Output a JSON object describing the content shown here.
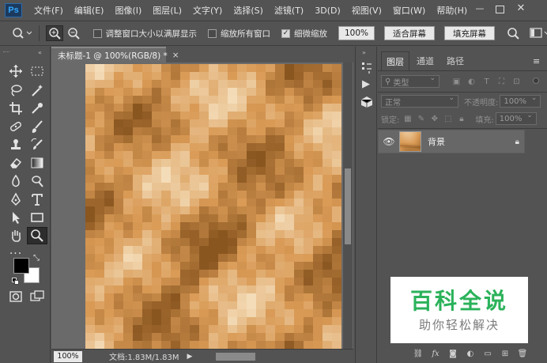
{
  "app": {
    "logo": "Ps"
  },
  "menu": [
    "文件(F)",
    "编辑(E)",
    "图像(I)",
    "图层(L)",
    "文字(Y)",
    "选择(S)",
    "滤镜(T)",
    "3D(D)",
    "视图(V)",
    "窗口(W)",
    "帮助(H)"
  ],
  "options": {
    "resize_windows_label": "调整窗口大小以满屏显示",
    "resize_windows_checked": false,
    "zoom_all_label": "缩放所有窗口",
    "zoom_all_checked": false,
    "scrubby_label": "细微缩放",
    "scrubby_checked": true,
    "percent_btn": "100%",
    "fit_screen_btn": "适合屏幕",
    "fill_screen_btn": "填充屏幕"
  },
  "document": {
    "tab_title": "未标题-1 @ 100%(RGB/8) *",
    "close_glyph": "×"
  },
  "status": {
    "zoom": "100%",
    "doc_size": "文档:1.83M/1.83M"
  },
  "layers_panel": {
    "tabs": [
      "图层",
      "通道",
      "路径"
    ],
    "filter_kind": "类型",
    "blend_mode": "正常",
    "opacity_label": "不透明度:",
    "opacity_value": "100%",
    "lock_label": "锁定:",
    "fill_label": "填充:",
    "fill_value": "100%",
    "layer_name": "背景"
  },
  "watermark": {
    "title": "百科全说",
    "subtitle": "助你轻松解决"
  },
  "colors": {
    "ui_bg": "#535353",
    "foreground": "#000000",
    "background": "#ffffff",
    "texture_light": "#f4dcb8",
    "texture_mid": "#d99a55",
    "texture_dark": "#8a5620",
    "watermark_green": "#2bb25a"
  },
  "icons": {
    "tools": [
      "move-icon",
      "marquee-icon",
      "lasso-icon",
      "magic-wand-icon",
      "crop-icon",
      "eyedropper-icon",
      "healing-brush-icon",
      "brush-icon",
      "clone-stamp-icon",
      "history-brush-icon",
      "eraser-icon",
      "gradient-icon",
      "blur-icon",
      "dodge-icon",
      "pen-icon",
      "type-icon",
      "path-select-icon",
      "rectangle-icon",
      "hand-icon",
      "zoom-icon"
    ]
  }
}
